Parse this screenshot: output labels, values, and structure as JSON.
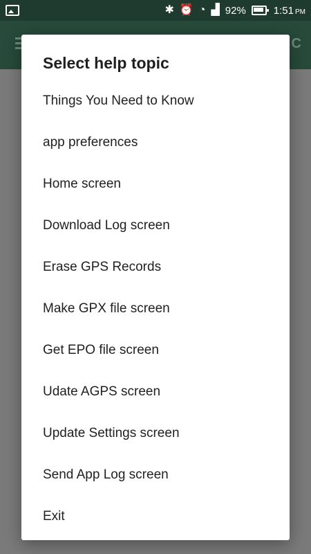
{
  "status_bar": {
    "battery_percent": "92%",
    "time": "1:51",
    "ampm": "PM"
  },
  "app_bar": {
    "right_partial": "C"
  },
  "dialog": {
    "title": "Select help topic",
    "topics": [
      {
        "label": "Things You Need to Know"
      },
      {
        "label": "app preferences"
      },
      {
        "label": "Home screen"
      },
      {
        "label": "Download Log screen"
      },
      {
        "label": "Erase GPS Records"
      },
      {
        "label": "Make GPX file screen"
      },
      {
        "label": "Get EPO file screen"
      },
      {
        "label": "Udate AGPS screen"
      },
      {
        "label": "Update Settings screen"
      },
      {
        "label": "Send App Log screen"
      },
      {
        "label": "Exit"
      }
    ]
  }
}
